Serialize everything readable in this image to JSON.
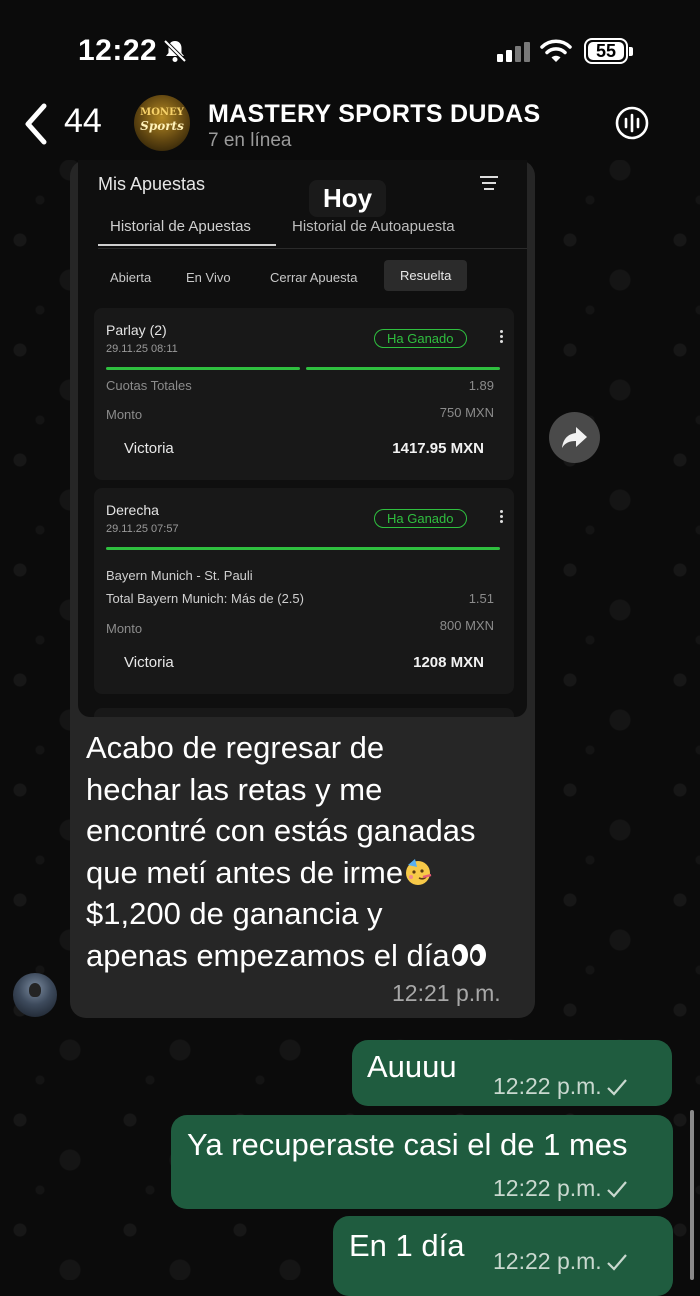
{
  "status_bar": {
    "time": "12:22",
    "battery": "55"
  },
  "chat_header": {
    "back_count": "44",
    "group_avatar_text_top": "MONEY",
    "group_avatar_text_bottom": "Sports",
    "title": "MASTERY SPORTS DUDAS",
    "subtitle": "7 en línea"
  },
  "date_chip": "Hoy",
  "bet_screenshot": {
    "title": "Mis Apuestas",
    "tabs": [
      "Historial de Apuestas",
      "Historial de Autoapuesta"
    ],
    "filters": [
      "Abierta",
      "En Vivo",
      "Cerrar Apuesta",
      "Resuelta"
    ],
    "active_filter": "Resuelta",
    "bets": [
      {
        "name": "Parlay (2)",
        "date": "29.11.25 08:11",
        "status": "Ha Ganado",
        "odds_label": "Cuotas Totales",
        "odds_value": "1.89",
        "amount_label": "Monto",
        "amount_value": "750 MXN",
        "win_label": "Victoria",
        "win_value": "1417.95 MXN"
      },
      {
        "name": "Derecha",
        "date": "29.11.25 07:57",
        "status": "Ha Ganado",
        "match": "Bayern Munich - St. Pauli",
        "market": "Total Bayern Munich: Más de (2.5)",
        "odds_value": "1.51",
        "amount_label": "Monto",
        "amount_value": "800 MXN",
        "win_label": "Victoria",
        "win_value": "1208 MXN"
      }
    ]
  },
  "incoming_message": {
    "lines": [
      "Acabo de regresar de",
      "hechar las retas y me",
      "encontré con estás ganadas",
      "que metí antes de irme",
      "$1,200 de ganancia y",
      "apenas empezamos el día"
    ],
    "time": "12:21 p.m."
  },
  "outgoing_messages": [
    {
      "text": "Auuuu",
      "time": "12:22 p.m."
    },
    {
      "text": "Ya recuperaste casi el de 1 mes",
      "time": "12:22 p.m."
    },
    {
      "text": "En 1 día",
      "time": "12:22 p.m."
    }
  ]
}
